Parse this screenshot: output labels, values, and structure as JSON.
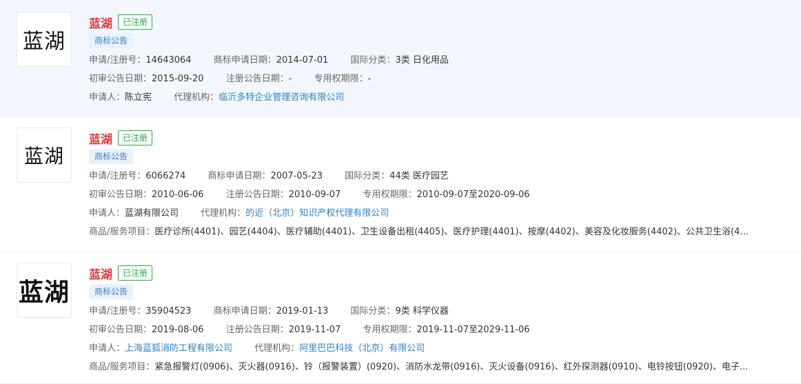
{
  "labels": {
    "reg_no": "申请/注册号：",
    "apply_date": "商标申请日期：",
    "intl_class": "国际分类：",
    "prelim_date": "初审公告日期：",
    "reg_ann_date": "注册公告日期：",
    "exclusive_period": "专用权期限：",
    "applicant": "申请人：",
    "agency": "代理机构：",
    "goods": "商品/服务项目："
  },
  "items": [
    {
      "logo_text": "蓝湖",
      "name": "蓝湖",
      "status": "已注册",
      "tag": "商标公告",
      "reg_no": "14643064",
      "apply_date": "2014-07-01",
      "intl_class": "3类 日化用品",
      "prelim_date": "2015-09-20",
      "reg_ann_date": "-",
      "exclusive_period": "-",
      "applicant": "陈立宪",
      "agency": "临沂多特企业管理咨询有限公司"
    },
    {
      "logo_text": "蓝湖",
      "name": "蓝湖",
      "status": "已注册",
      "tag": "商标公告",
      "reg_no": "6066274",
      "apply_date": "2007-05-23",
      "intl_class": "44类 医疗园艺",
      "prelim_date": "2010-06-06",
      "reg_ann_date": "2010-09-07",
      "exclusive_period": "2010-09-07至2020-09-06",
      "applicant": "蓝湖有限公司",
      "agency": "的近（北京）知识产权代理有限公司",
      "goods": "医疗诊所(4401)、园艺(4404)、医疗辅助(4401)、卫生设备出租(4405)、医疗护理(4401)、按摩(4402)、美容及化妆服务(4402)、公共卫生浴(4..."
    },
    {
      "logo_text": "蓝湖",
      "name": "蓝湖",
      "status": "已注册",
      "tag": "商标公告",
      "reg_no": "35904523",
      "apply_date": "2019-01-13",
      "intl_class": "9类 科学仪器",
      "prelim_date": "2019-08-06",
      "reg_ann_date": "2019-11-07",
      "exclusive_period": "2019-11-07至2029-11-06",
      "applicant": "上海蓝狐消防工程有限公司",
      "agency": "阿里巴巴科技（北京）有限公司",
      "goods": "紧急报警灯(0906)、灭火器(0916)、铃（报警装置）(0920)、消防水龙带(0916)、灭火设备(0916)、红外探测器(0910)、电铃按钮(0920)、电子..."
    }
  ]
}
